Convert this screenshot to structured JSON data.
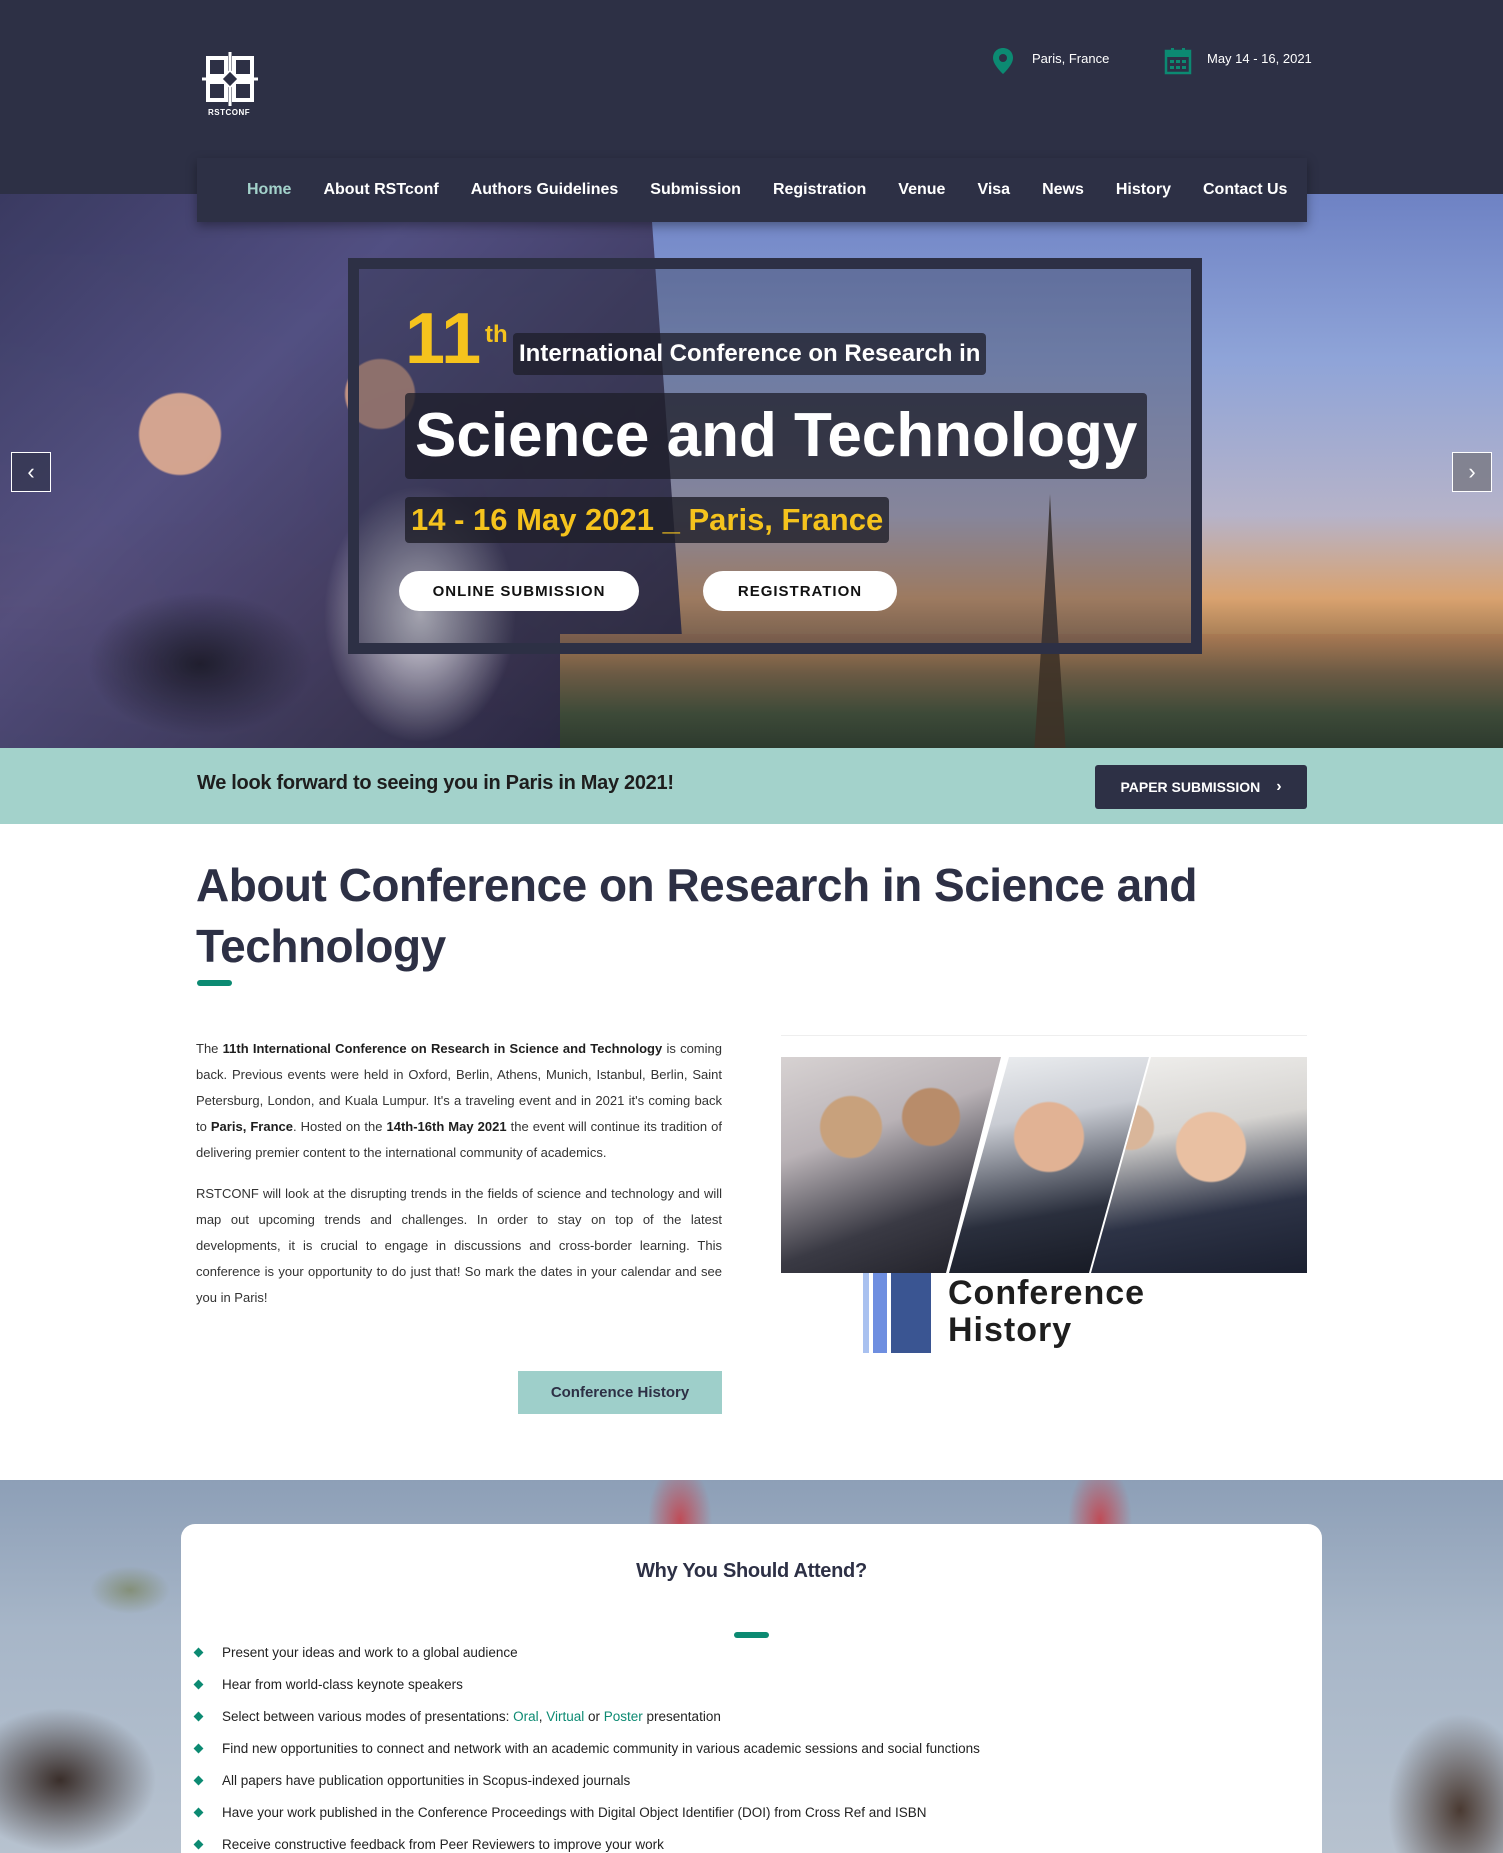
{
  "header": {
    "logo_text": "RSTCONF",
    "location": "Paris, France",
    "dates": "May 14 - 16, 2021",
    "accent": "#0c8a72",
    "bg": "#2d3045"
  },
  "nav": {
    "items": [
      "Home",
      "About RSTconf",
      "Authors Guidelines",
      "Submission",
      "Registration",
      "Venue",
      "Visa",
      "News",
      "History",
      "Contact Us"
    ],
    "active": "Home"
  },
  "hero": {
    "number": "11",
    "ordinal": "th",
    "subtitle": "International Conference on Research in",
    "title": "Science and Technology",
    "date_line": "14 - 16 May 2021 _ Paris, France",
    "buttons": {
      "submission": "ONLINE SUBMISSION",
      "registration": "REGISTRATION"
    },
    "prev_icon": "chevron-left-icon",
    "next_icon": "chevron-right-icon",
    "accent": "#f5c31d"
  },
  "strip": {
    "text": "We look forward to seeing you in Paris in May 2021!",
    "button": "PAPER SUBMISSION",
    "bg": "#a3d2cb"
  },
  "about": {
    "title": "About Conference on Research in Science and Technology",
    "p1": {
      "t1": "The ",
      "b1": "11th International Conference on Research in Science and Technology",
      "t2": " is coming back. Previous events were held in Oxford, Berlin, Athens, Munich, Istanbul, Berlin, Saint Petersburg, London, and Kuala Lumpur. It's a traveling event and in 2021 it's coming back to ",
      "b2": "Paris, France",
      "t3": ". Hosted on the ",
      "b3": "14th-16th May 2021",
      "t4": " the event will continue its tradition of delivering premier content to the international community of academics."
    },
    "p2": "RSTCONF will look at the disrupting trends in the fields of science and technology and will map out upcoming trends and challenges. In order to stay on top of the latest developments, it is crucial to engage in discussions and cross-border learning. This conference is your opportunity to do just that! So mark the dates in your calendar and see you in Paris!",
    "button": "Conference History",
    "history_card": {
      "line1": "Conference",
      "line2": "History"
    }
  },
  "attend": {
    "title": "Why You Should Attend?",
    "items": [
      "Present your ideas and work to a global audience",
      "Hear from world-class keynote speakers",
      "Find new opportunities to connect and network with an academic community in various academic sessions and social functions",
      "All papers have publication opportunities in Scopus-indexed journals",
      "Have your work published in the Conference Proceedings with Digital Object Identifier (DOI) from Cross Ref and ISBN",
      "Receive constructive feedback from Peer Reviewers to improve your work"
    ],
    "modes_item": {
      "prefix": "Select between various modes of presentations: ",
      "mode1": "Oral",
      "sep1": ", ",
      "mode2": "Virtual",
      "sep2": " or ",
      "mode3": "Poster",
      "suffix": " presentation"
    }
  }
}
